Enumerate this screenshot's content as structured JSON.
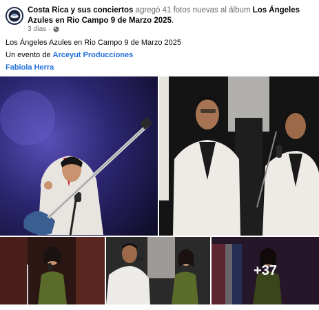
{
  "post": {
    "page_name": "Costa Rica y sus conciertos",
    "action_text": " agregó 41 fotos nuevas al álbum ",
    "album_name": "Los Ángeles Azules en Rio Campo 9 de Marzo 2025",
    "album_suffix": ".",
    "time_ago": "3 días",
    "audience_icon": "globe-icon",
    "caption": "Los Ángeles Azules en Rio Campo 9 de Marzo 2025",
    "event_prefix": "Un evento de ",
    "event_org": "Arceyut Producciones",
    "tagged_person": "Fabiola Herra"
  },
  "gallery": {
    "more_count": "+37"
  },
  "colors": {
    "link": "#216fdb",
    "muted": "#65676b"
  }
}
